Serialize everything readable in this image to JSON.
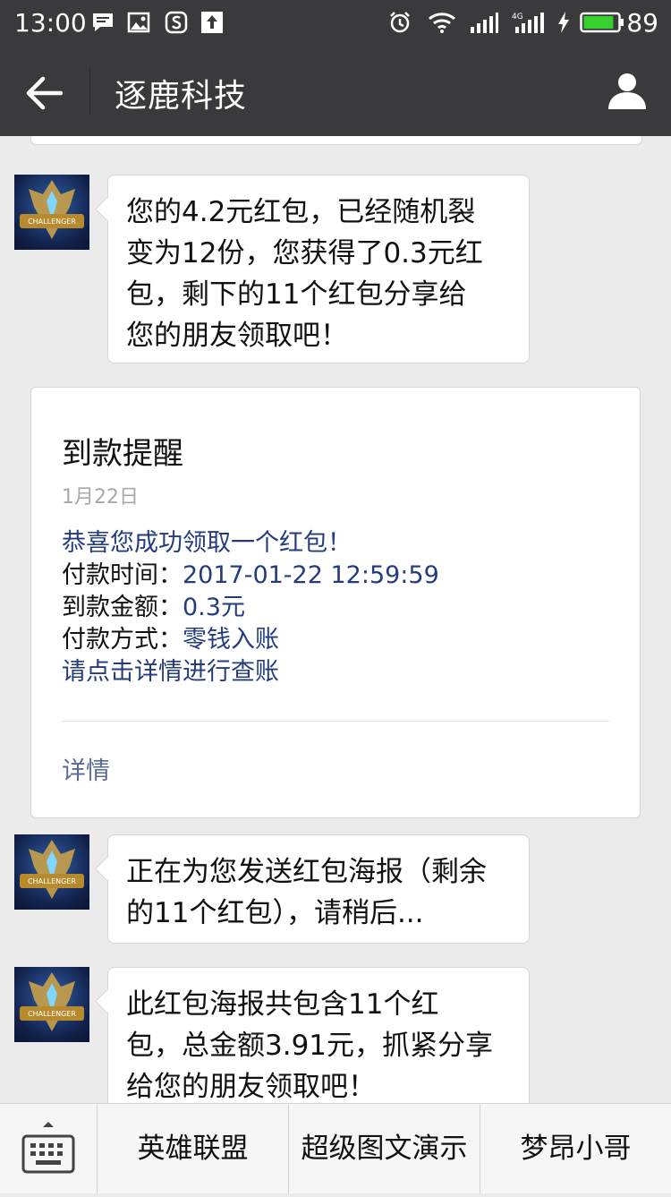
{
  "status_bar": {
    "time": "13:00",
    "battery_percent": "89",
    "network_label": "4G",
    "icons": [
      "message-icon",
      "image-icon",
      "s-app-icon",
      "upload-icon",
      "alarm-icon",
      "wifi-icon",
      "signal-icon",
      "signal-4g-icon",
      "charging-icon",
      "battery-icon"
    ]
  },
  "header": {
    "title": "逐鹿科技",
    "back_icon": "arrow-left-icon",
    "profile_icon": "person-icon"
  },
  "messages": [
    {
      "type": "text",
      "sender_avatar": "challenger-tournament-avatar",
      "text_lines": [
        "您的4.2元红包，已经随机裂",
        "变为12份，您获得了0.3元红",
        "包，剩下的11个红包分享给",
        "您的朋友领取吧！"
      ]
    },
    {
      "type": "card",
      "title": "到款提醒",
      "date": "1月22日",
      "lines": [
        {
          "label": "",
          "value": "恭喜您成功领取一个红包！"
        },
        {
          "label": "付款时间：",
          "value": "2017-01-22 12:59:59"
        },
        {
          "label": "到款金额：",
          "value": "0.3元"
        },
        {
          "label": "付款方式：",
          "value": "零钱入账"
        },
        {
          "label": "",
          "value": "请点击详情进行查账"
        }
      ],
      "detail_label": "详情"
    },
    {
      "type": "text",
      "sender_avatar": "challenger-tournament-avatar",
      "text_lines": [
        "正在为您发送红包海报（剩余",
        "的11个红包），请稍后..."
      ]
    },
    {
      "type": "text",
      "sender_avatar": "challenger-tournament-avatar",
      "text_lines": [
        "此红包海报共包含11个红",
        "包，总金额3.91元，抓紧分享",
        "给您的朋友领取吧！"
      ]
    }
  ],
  "avatar_text": "CHALLENGER",
  "bottom_menu": {
    "keyboard_icon": "keyboard-icon",
    "items": [
      "英雄联盟",
      "超级图文演示",
      "梦昂小哥"
    ]
  },
  "colors": {
    "header_bg": "#3a3a3c",
    "chat_bg": "#ebebeb",
    "link_blue": "#576b95",
    "value_blue": "#243c7e",
    "battery_green": "#36d12e"
  }
}
